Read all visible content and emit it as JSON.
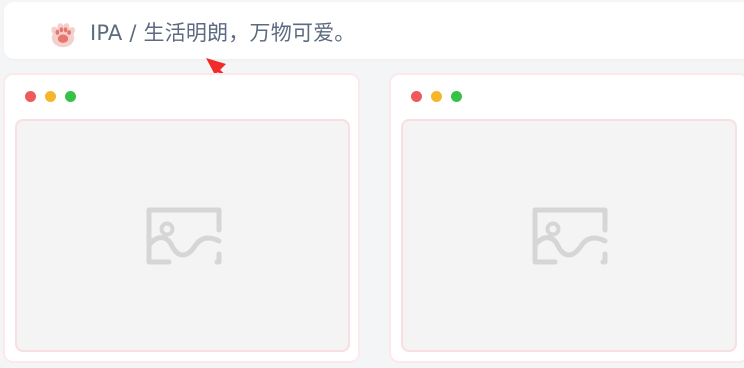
{
  "banner": {
    "text": "IPA / 生活明朗，万物可爱。",
    "icon": "paw-icon"
  },
  "annotation": {
    "type": "arrow",
    "color": "#ef2b2b"
  },
  "cards": [
    {
      "window_controls": [
        "red",
        "yellow",
        "green"
      ],
      "image_icon": "image-placeholder-icon"
    },
    {
      "window_controls": [
        "red",
        "yellow",
        "green"
      ],
      "image_icon": "image-placeholder-icon"
    }
  ],
  "colors": {
    "background": "#f4f5f7",
    "banner_text": "#5d6b80",
    "card_border": "#fde8ea",
    "dot_red": "#ef5a5a",
    "dot_yellow": "#f6b62a",
    "dot_green": "#35c247",
    "placeholder_gray": "#d6d6d6"
  }
}
